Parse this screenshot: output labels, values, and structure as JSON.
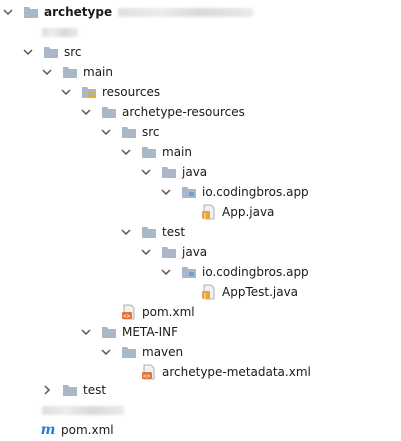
{
  "tree": {
    "root_label": "archetype",
    "nodes": {
      "src": "src",
      "main": "main",
      "resources": "resources",
      "archetype_resources": "archetype-resources",
      "ar_src": "src",
      "ar_main": "main",
      "ar_main_java": "java",
      "ar_main_pkg": "io.codingbros.app",
      "app_java": "App.java",
      "ar_test": "test",
      "ar_test_java": "java",
      "ar_test_pkg": "io.codingbros.app",
      "apptest_java": "AppTest.java",
      "ar_pom": "pom.xml",
      "meta_inf": "META-INF",
      "maven": "maven",
      "metadata_xml": "archetype-metadata.xml",
      "test": "test",
      "root_pom": "pom.xml"
    }
  },
  "colors": {
    "folder": "#a9b7c6",
    "source_folder": "#6aa0d8",
    "test_folder": "#7cb67a",
    "java_badge": "#e8a33a",
    "xml_badge": "#e0763c",
    "maven": "#2b7bd6"
  }
}
